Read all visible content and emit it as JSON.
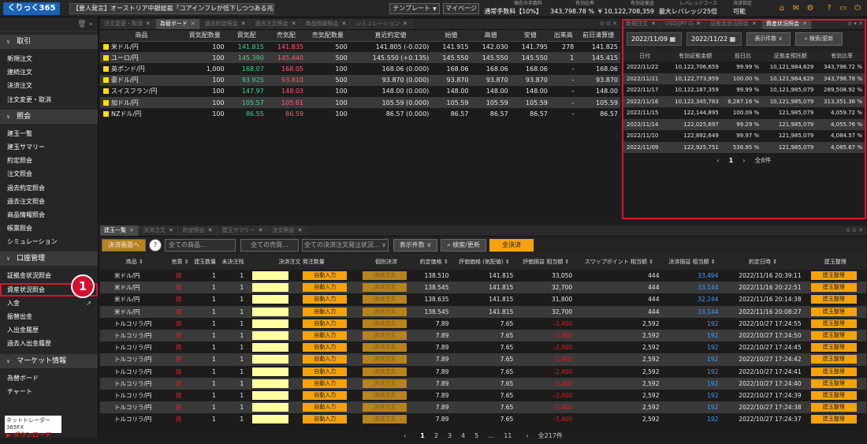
{
  "header": {
    "logo": "くりっく365",
    "news": "【要人発言】オーストリア中銀総裁「コアインフレが低下しつつある兆候は見ら…",
    "template": "テンプレート",
    "mypage": "マイページ",
    "stats": [
      {
        "label": "現在の手数料",
        "value": "通常手数料【10%】"
      },
      {
        "label": "有効比率",
        "value": "343,798.78 %"
      },
      {
        "label": "有効証拠金",
        "value": "¥ 10,122,708,359"
      },
      {
        "label": "レバレッジコース",
        "value": "最大レバレッジ25倍"
      },
      {
        "label": "決済指定",
        "value": "可能"
      }
    ]
  },
  "sidebar": {
    "sections": [
      {
        "title": "取引",
        "items": [
          "新規注文",
          "連続注文",
          "決済注文",
          "注文変更・取消"
        ]
      },
      {
        "title": "照会",
        "items": [
          "建玉一覧",
          "建玉サマリー",
          "約定照会",
          "注文照会",
          "過去約定照会",
          "過去注文照会",
          "商品情報照会",
          "帳票照会",
          "シミュレーション"
        ]
      },
      {
        "title": "口座管理",
        "items": [
          "証拠金状況照会",
          "資産状況照会",
          "入金",
          "振替出金",
          "入出金履歴",
          "過去入出金履歴"
        ]
      },
      {
        "title": "マーケット情報",
        "items": [
          "為替ボード",
          "チャート"
        ]
      }
    ],
    "download": {
      "line1": "ネットトレーダー365FX",
      "line2": "ダウンロード"
    },
    "callout": "1"
  },
  "rate_panel": {
    "tabs": [
      "注文変更・取消",
      "為替ボード",
      "過去約定照会",
      "過去注文照会",
      "商品情報照会",
      "シミュレーション"
    ],
    "active": 1,
    "headers": [
      "商品",
      "買気配数量",
      "買気配",
      "売気配",
      "売気配数量",
      "直近約定値",
      "始値",
      "高値",
      "安値",
      "出来高",
      "前日清算値"
    ],
    "rows": [
      [
        "米ドル/円",
        "100",
        "141.815",
        "141.835",
        "500",
        "141.805 (-0.020)",
        "141.915",
        "142.030",
        "141.795",
        "278",
        "141.825"
      ],
      [
        "ユーロ/円",
        "100",
        "145.390",
        "145.440",
        "500",
        "145.550 (+0.135)",
        "145.550",
        "145.550",
        "145.550",
        "1",
        "145.415"
      ],
      [
        "英ポンド/円",
        "1,000",
        "168.07",
        "168.05",
        "100",
        "168.06 (0.000)",
        "168.06",
        "168.06",
        "168.06",
        "-",
        "168.06"
      ],
      [
        "豪ドル/円",
        "100",
        "93.925",
        "93.810",
        "500",
        "93.870 (0.000)",
        "93.870",
        "93.870",
        "93.870",
        "-",
        "93.870"
      ],
      [
        "スイスフラン/円",
        "100",
        "147.97",
        "148.03",
        "100",
        "148.00 (0.000)",
        "148.00",
        "148.00",
        "148.00",
        "-",
        "148.00"
      ],
      [
        "加ドル/円",
        "100",
        "105.57",
        "105.61",
        "100",
        "105.59 (0.000)",
        "105.59",
        "105.59",
        "105.59",
        "-",
        "105.59"
      ],
      [
        "NZドル/円",
        "100",
        "86.55",
        "86.59",
        "100",
        "86.57 (0.000)",
        "86.57",
        "86.57",
        "86.57",
        "-",
        "86.57"
      ]
    ]
  },
  "asset_panel": {
    "tabs": [
      "新規注文",
      "USD/JPY D",
      "証拠金状況照会",
      "資産状況照会"
    ],
    "active": 3,
    "date_from": "2022/11/09",
    "date_to": "2022/11/22",
    "count_label": "表示件数",
    "search_label": "検索/更新",
    "headers": [
      "日付",
      "有効証拠金額",
      "前日比",
      "証拠金預託額",
      "有効比率"
    ],
    "rows": [
      [
        "2022/11/22",
        "10,122,706,659",
        "99.99 %",
        "10,121,984,629",
        "343,798.72 %"
      ],
      [
        "2022/11/21",
        "10,122,773,959",
        "100.00 %",
        "10,121,984,629",
        "343,798.78 %"
      ],
      [
        "2022/11/17",
        "10,122,187,359",
        "99.99 %",
        "10,121,985,079",
        "289,508.92 %"
      ],
      [
        "2022/11/16",
        "10,122,345,783",
        "8,287.16 %",
        "10,121,985,079",
        "313,351.36 %"
      ],
      [
        "2022/11/15",
        "122,144,895",
        "100.09 %",
        "121,985,079",
        "4,059.72 %"
      ],
      [
        "2022/11/14",
        "122,025,697",
        "99.29 %",
        "121,985,079",
        "4,055.76 %"
      ],
      [
        "2022/11/10",
        "122,892,649",
        "99.97 %",
        "121,985,079",
        "4,084.57 %"
      ],
      [
        "2022/11/09",
        "122,925,751",
        "536.95 %",
        "121,985,079",
        "4,085.67 %"
      ]
    ],
    "page": "1",
    "total": "全8件"
  },
  "positions_panel": {
    "tabs": [
      "建玉一覧",
      "決済注文",
      "約定照会",
      "建玉サマリー",
      "注文照会"
    ],
    "active": 0,
    "toolbar": {
      "close_screen": "決済画面へ",
      "help": "?",
      "all_products": "全ての商品...",
      "all_buysell": "全ての売買...",
      "all_status": "全ての決済注文発注状況...",
      "count": "表示件数",
      "search": "検索/更新",
      "close_all": "全決済"
    },
    "headers": [
      "商品",
      "売買",
      "建玉数量",
      "未決注残",
      "決済注文 発注数量",
      "",
      "個別決済",
      "約定価格",
      "評価価格 (気配値)",
      "評価損益 相当額",
      "スワップポイント 相当額",
      "決済損益 相当額",
      "約定日時",
      "建玉整理"
    ],
    "auto_input": "自動入力",
    "close_btn": "決済注文",
    "arrange_btn": "建玉整理",
    "rows": [
      [
        "米ドル/円",
        "買",
        "1",
        "1",
        "138.510",
        "141.815",
        "33,050",
        "444",
        "33,494",
        "2022/11/16 20:39:11"
      ],
      [
        "米ドル/円",
        "買",
        "1",
        "1",
        "138.545",
        "141.815",
        "32,700",
        "444",
        "33,144",
        "2022/11/16 20:22:51"
      ],
      [
        "米ドル/円",
        "買",
        "1",
        "1",
        "138.635",
        "141.815",
        "31,800",
        "444",
        "32,244",
        "2022/11/16 20:14:38"
      ],
      [
        "米ドル/円",
        "買",
        "1",
        "1",
        "138.545",
        "141.815",
        "32,700",
        "444",
        "33,144",
        "2022/11/16 20:08:27"
      ],
      [
        "トルコリラ/円",
        "買",
        "1",
        "1",
        "7.89",
        "7.65",
        "-2,400",
        "2,592",
        "192",
        "2022/10/27 17:24:55"
      ],
      [
        "トルコリラ/円",
        "買",
        "1",
        "1",
        "7.89",
        "7.65",
        "-2,400",
        "2,592",
        "192",
        "2022/10/27 17:24:50"
      ],
      [
        "トルコリラ/円",
        "買",
        "1",
        "1",
        "7.89",
        "7.65",
        "-2,400",
        "2,592",
        "192",
        "2022/10/27 17:24:45"
      ],
      [
        "トルコリラ/円",
        "買",
        "1",
        "1",
        "7.89",
        "7.65",
        "-2,400",
        "2,592",
        "192",
        "2022/10/27 17:24:42"
      ],
      [
        "トルコリラ/円",
        "買",
        "1",
        "1",
        "7.89",
        "7.65",
        "-2,400",
        "2,592",
        "192",
        "2022/10/27 17:24:41"
      ],
      [
        "トルコリラ/円",
        "買",
        "1",
        "1",
        "7.89",
        "7.65",
        "-2,400",
        "2,592",
        "192",
        "2022/10/27 17:24:40"
      ],
      [
        "トルコリラ/円",
        "買",
        "1",
        "1",
        "7.89",
        "7.65",
        "-2,400",
        "2,592",
        "192",
        "2022/10/27 17:24:39"
      ],
      [
        "トルコリラ/円",
        "買",
        "1",
        "1",
        "7.89",
        "7.65",
        "-2,400",
        "2,592",
        "192",
        "2022/10/27 17:24:38"
      ],
      [
        "トルコリラ/円",
        "買",
        "1",
        "1",
        "7.89",
        "7.65",
        "-2,400",
        "2,592",
        "192",
        "2022/10/27 17:24:37"
      ]
    ],
    "pages": [
      "1",
      "2",
      "3",
      "4",
      "5",
      "…",
      "11"
    ],
    "total": "全217件"
  },
  "colors": {
    "accent": "#f5a20c",
    "highlight": "#e0102f",
    "bid": "#43d08a",
    "ask": "#ff5a6a",
    "profit": "#3aa0ff",
    "loss": "#e02020"
  }
}
